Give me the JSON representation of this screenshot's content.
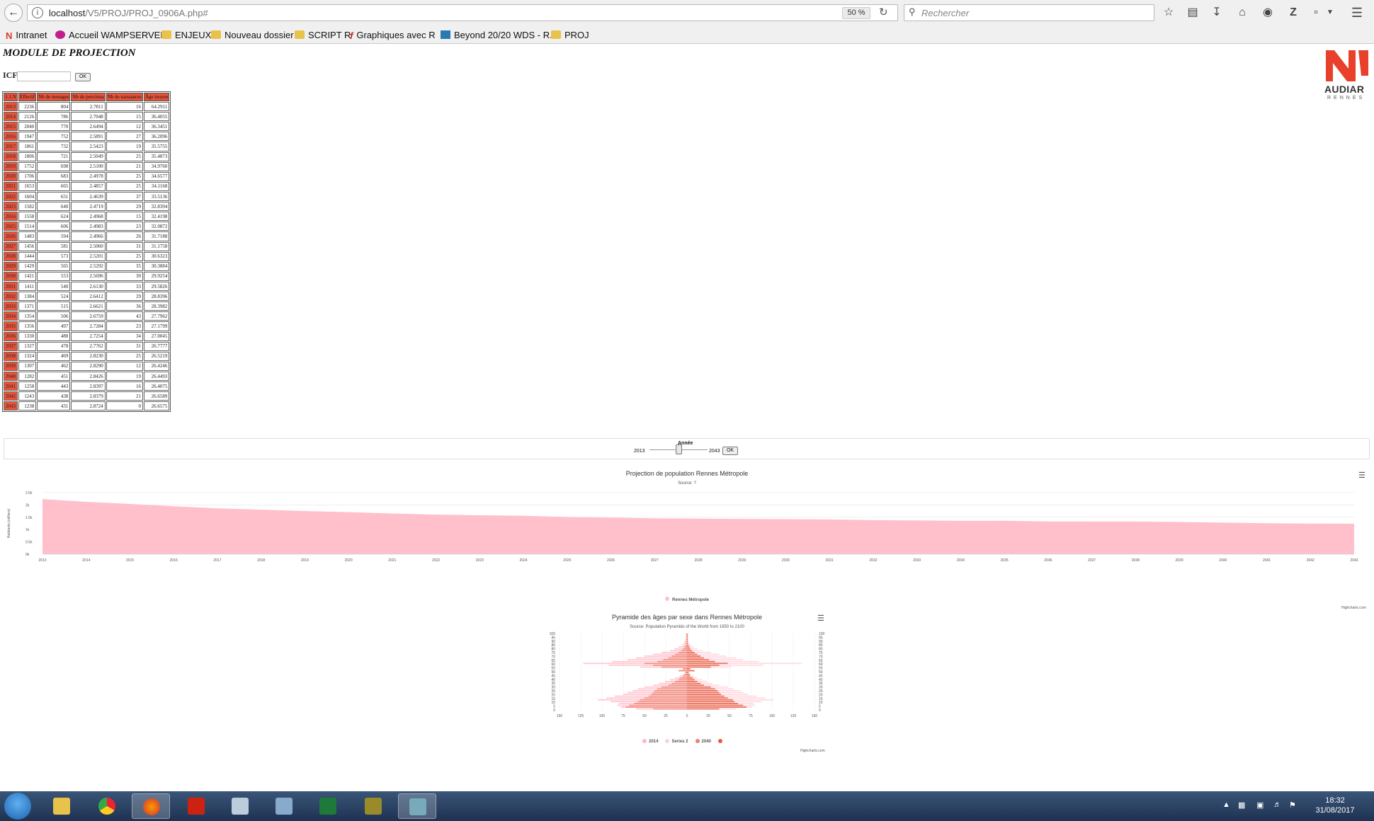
{
  "browser": {
    "url_host": "localhost",
    "url_path": "/V5/PROJ/PROJ_0906A.php#",
    "zoom": "50 %",
    "search_placeholder": "Rechercher"
  },
  "bookmarks": [
    {
      "label": "Intranet",
      "icon": "audiar-icon"
    },
    {
      "label": "Accueil WAMPSERVER",
      "icon": "wamp-icon"
    },
    {
      "label": "ENJEUX",
      "icon": "folder-icon"
    },
    {
      "label": "Nouveau dossier",
      "icon": "folder-icon"
    },
    {
      "label": "SCRIPT R",
      "icon": "folder-icon"
    },
    {
      "label": "Graphiques avec R",
      "icon": "f-icon"
    },
    {
      "label": "Beyond 20/20 WDS - R...",
      "icon": "beyond-icon"
    },
    {
      "label": "PROJ",
      "icon": "folder-icon"
    }
  ],
  "page": {
    "title": "MODULE DE PROJECTION",
    "icf_label": "ICF",
    "ok_label": "OK",
    "logo_text": "AUDIAR",
    "logo_sub": "RENNES"
  },
  "table": {
    "headers": [
      "1.1.N",
      "Effectif",
      "Nb de menages",
      "Nb de pers/mna",
      "Nb de naissances",
      "Âge moyen"
    ],
    "rows": [
      [
        "2013",
        "2236",
        "804",
        "2.7811",
        "16",
        "64.2911"
      ],
      [
        "2014",
        "2126",
        "786",
        "2.7048",
        "15",
        "36.4055"
      ],
      [
        "2015",
        "2040",
        "770",
        "2.6494",
        "12",
        "36.3451"
      ],
      [
        "2016",
        "1947",
        "752",
        "2.5891",
        "27",
        "36.2096"
      ],
      [
        "2017",
        "1861",
        "732",
        "2.5423",
        "19",
        "35.5755"
      ],
      [
        "2018",
        "1806",
        "721",
        "2.5049",
        "25",
        "35.4873"
      ],
      [
        "2019",
        "1752",
        "698",
        "2.5100",
        "21",
        "34.9760"
      ],
      [
        "2020",
        "1706",
        "683",
        "2.4978",
        "25",
        "34.6577"
      ],
      [
        "2021",
        "1653",
        "665",
        "2.4857",
        "25",
        "34.1168"
      ],
      [
        "2022",
        "1604",
        "651",
        "2.4639",
        "37",
        "33.5136"
      ],
      [
        "2023",
        "1582",
        "640",
        "2.4719",
        "29",
        "32.8394"
      ],
      [
        "2024",
        "1558",
        "624",
        "2.4968",
        "15",
        "32.4198"
      ],
      [
        "2025",
        "1514",
        "606",
        "2.4983",
        "23",
        "32.0872"
      ],
      [
        "2026",
        "1483",
        "594",
        "2.4966",
        "26",
        "31.7188"
      ],
      [
        "2027",
        "1456",
        "581",
        "2.5060",
        "31",
        "31.1758"
      ],
      [
        "2028",
        "1444",
        "573",
        "2.5201",
        "25",
        "30.6323"
      ],
      [
        "2029",
        "1429",
        "565",
        "2.5292",
        "35",
        "30.3884"
      ],
      [
        "2030",
        "1421",
        "553",
        "2.5696",
        "30",
        "29.9254"
      ],
      [
        "2031",
        "1411",
        "540",
        "2.6130",
        "33",
        "29.5826"
      ],
      [
        "2032",
        "1384",
        "524",
        "2.6412",
        "29",
        "28.8396"
      ],
      [
        "2033",
        "1371",
        "515",
        "2.6621",
        "36",
        "28.3982"
      ],
      [
        "2034",
        "1354",
        "506",
        "2.6759",
        "43",
        "27.7962"
      ],
      [
        "2035",
        "1356",
        "497",
        "2.7284",
        "23",
        "27.1799"
      ],
      [
        "2036",
        "1330",
        "488",
        "2.7254",
        "34",
        "27.0045"
      ],
      [
        "2037",
        "1327",
        "478",
        "2.7762",
        "31",
        "26.7777"
      ],
      [
        "2038",
        "1324",
        "469",
        "2.8230",
        "25",
        "26.5219"
      ],
      [
        "2039",
        "1307",
        "462",
        "2.8290",
        "12",
        "26.4246"
      ],
      [
        "2040",
        "1282",
        "451",
        "2.8426",
        "19",
        "26.4493"
      ],
      [
        "2041",
        "1258",
        "443",
        "2.8397",
        "16",
        "26.4075"
      ],
      [
        "2042",
        "1243",
        "438",
        "2.8379",
        "21",
        "26.6589"
      ],
      [
        "2043",
        "1238",
        "431",
        "2.8724",
        "0",
        "26.6575"
      ]
    ]
  },
  "slider": {
    "label": "Année",
    "min": "2013",
    "max": "2043",
    "min_value": 2013,
    "max_value": 2043,
    "value": 2028,
    "ok_label": "OK"
  },
  "chart_data": [
    {
      "type": "area",
      "title": "Projection de population Rennes Métropole",
      "subtitle": "Source: ?",
      "ylabel": "Habitants (milliers)",
      "xlabel": "",
      "ylim": [
        0,
        2500
      ],
      "yticks": [
        "0k",
        "0.5k",
        "1k",
        "1.5k",
        "2k",
        "2.5k"
      ],
      "ytick_values": [
        0,
        500,
        1000,
        1500,
        2000,
        2500
      ],
      "x": [
        2013,
        2014,
        2015,
        2016,
        2017,
        2018,
        2019,
        2020,
        2021,
        2022,
        2023,
        2024,
        2025,
        2026,
        2027,
        2028,
        2029,
        2030,
        2031,
        2032,
        2033,
        2034,
        2035,
        2036,
        2037,
        2038,
        2039,
        2040,
        2041,
        2042,
        2043
      ],
      "series": [
        {
          "name": "Rennes Métropole",
          "color": "#ffc0cb",
          "values": [
            2236,
            2126,
            2040,
            1947,
            1861,
            1806,
            1752,
            1706,
            1653,
            1604,
            1582,
            1558,
            1514,
            1483,
            1456,
            1444,
            1429,
            1421,
            1411,
            1384,
            1371,
            1354,
            1356,
            1330,
            1327,
            1324,
            1307,
            1282,
            1258,
            1243,
            1238
          ]
        }
      ],
      "grid": true,
      "legend": "bottom",
      "credits": "Highcharts.com"
    },
    {
      "type": "bar",
      "title": "Pyramide des âges par sexe dans Rennes Métropole",
      "subtitle": "Source: Population Pyramids of the World from 1950 to 2100",
      "ages": [
        0,
        5,
        10,
        15,
        20,
        25,
        30,
        35,
        40,
        45,
        50,
        55,
        60,
        65,
        70,
        75,
        80,
        85,
        90,
        95,
        100
      ],
      "age_ticks": [
        "0",
        "5",
        "10",
        "15",
        "20",
        "25",
        "30",
        "35",
        "40",
        "45",
        "50",
        "55",
        "60",
        "65",
        "70",
        "75",
        "80",
        "85",
        "90",
        "95",
        "100"
      ],
      "xlim": [
        -150,
        150
      ],
      "xticks": [
        "150",
        "125",
        "100",
        "75",
        "50",
        "25",
        "0",
        "25",
        "50",
        "75",
        "100",
        "125",
        "150"
      ],
      "xtick_values": [
        -150,
        -125,
        -100,
        -75,
        -50,
        -25,
        0,
        25,
        50,
        75,
        100,
        125,
        150
      ],
      "series": [
        {
          "name": "2014",
          "color": "#ffb6c1",
          "side": "left",
          "values": [
            -60,
            -78,
            -82,
            -80,
            -90,
            -105,
            -95,
            -85,
            -75,
            -70,
            -64,
            -58,
            -50,
            -40,
            -33,
            -26,
            -20,
            -14,
            -9,
            -5,
            -2,
            -8,
            -4,
            -55,
            -92,
            -122,
            -88,
            -70,
            -60,
            -50,
            -40,
            -30,
            -20,
            -15,
            -10,
            -6,
            -4,
            -3,
            -2,
            -1,
            -1,
            -1
          ]
        },
        {
          "name": "Series 2",
          "color": "#ffcfd8",
          "side": "right",
          "values": [
            58,
            76,
            80,
            78,
            88,
            102,
            92,
            82,
            72,
            66,
            62,
            55,
            48,
            38,
            30,
            24,
            18,
            12,
            8,
            4,
            2,
            6,
            3,
            52,
            90,
            135,
            85,
            66,
            58,
            46,
            38,
            28,
            18,
            12,
            8,
            5,
            3,
            2,
            1,
            1,
            1,
            1
          ]
        },
        {
          "name": "2040",
          "color": "#f08070",
          "side": "left",
          "values": [
            -40,
            -72,
            -68,
            -62,
            -58,
            -55,
            -50,
            -45,
            -42,
            -40,
            -38,
            -35,
            -30,
            -22,
            -18,
            -14,
            -10,
            -8,
            -5,
            -3,
            -2,
            -10,
            -5,
            -30,
            -40,
            -50,
            -35,
            -28,
            -22,
            -18,
            -14,
            -10,
            -7,
            -5,
            -3,
            -2,
            -1,
            -1,
            -1,
            -1,
            -1,
            -1
          ]
        },
        {
          "name": "",
          "color": "#e85a40",
          "side": "right",
          "values": [
            38,
            70,
            66,
            60,
            56,
            54,
            48,
            44,
            40,
            38,
            36,
            33,
            28,
            20,
            16,
            12,
            9,
            7,
            4,
            3,
            2,
            9,
            4,
            28,
            38,
            48,
            33,
            26,
            20,
            16,
            12,
            9,
            6,
            4,
            3,
            2,
            1,
            1,
            1,
            1,
            1,
            1
          ]
        }
      ],
      "grid": true,
      "legend": "bottom",
      "credits": "Highcharts.com"
    }
  ],
  "taskbar": {
    "time": "18:32",
    "date": "31/08/2017",
    "apps": [
      "explorer",
      "chrome",
      "firefox",
      "acrobat",
      "calculator",
      "notepad",
      "excel",
      "txc",
      "notes"
    ]
  }
}
